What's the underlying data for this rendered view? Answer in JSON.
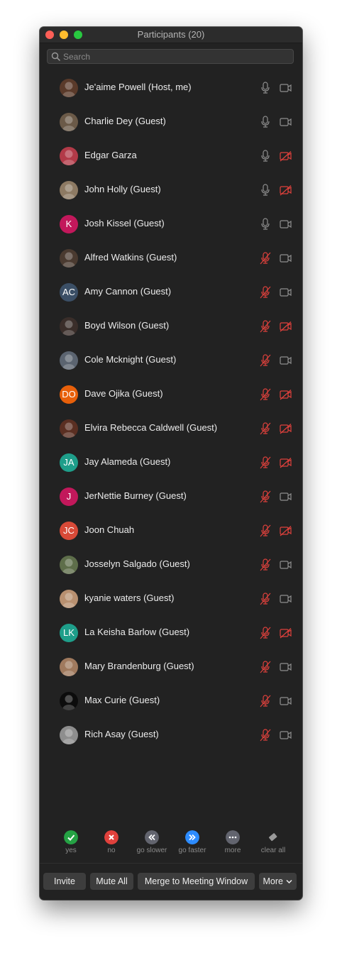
{
  "window": {
    "title": "Participants (20)"
  },
  "search": {
    "placeholder": "Search"
  },
  "participants": [
    {
      "name": "Je'aime Powell (Host, me)",
      "avatar_initials": "",
      "avatar_color": "#5a3a2a",
      "mic": "on",
      "video": "on"
    },
    {
      "name": "Charlie Dey (Guest)",
      "avatar_initials": "",
      "avatar_color": "#6b5a48",
      "mic": "on",
      "video": "on"
    },
    {
      "name": "Edgar Garza",
      "avatar_initials": "",
      "avatar_color": "#b23a48",
      "mic": "on",
      "video": "off"
    },
    {
      "name": "John Holly (Guest)",
      "avatar_initials": "",
      "avatar_color": "#8d7a63",
      "mic": "on",
      "video": "off"
    },
    {
      "name": "Josh Kissel (Guest)",
      "avatar_initials": "K",
      "avatar_color": "#c2185b",
      "mic": "on",
      "video": "on"
    },
    {
      "name": "Alfred Watkins (Guest)",
      "avatar_initials": "",
      "avatar_color": "#4a3a30",
      "mic": "muted",
      "video": "on"
    },
    {
      "name": "Amy Cannon (Guest)",
      "avatar_initials": "AC",
      "avatar_color": "#3b4f66",
      "mic": "muted",
      "video": "on"
    },
    {
      "name": "Boyd Wilson (Guest)",
      "avatar_initials": "",
      "avatar_color": "#3a2e2a",
      "mic": "muted",
      "video": "off"
    },
    {
      "name": "Cole Mcknight (Guest)",
      "avatar_initials": "",
      "avatar_color": "#5b6470",
      "mic": "muted",
      "video": "on"
    },
    {
      "name": "Dave Ojika (Guest)",
      "avatar_initials": "DO",
      "avatar_color": "#e8600a",
      "mic": "muted",
      "video": "off"
    },
    {
      "name": "Elvira Rebecca Caldwell (Guest)",
      "avatar_initials": "",
      "avatar_color": "#5a2f22",
      "mic": "muted",
      "video": "off"
    },
    {
      "name": "Jay Alameda (Guest)",
      "avatar_initials": "JA",
      "avatar_color": "#1e9e8a",
      "mic": "muted",
      "video": "off"
    },
    {
      "name": "JerNettie Burney (Guest)",
      "avatar_initials": "J",
      "avatar_color": "#c2185b",
      "mic": "muted",
      "video": "on"
    },
    {
      "name": "Joon Chuah",
      "avatar_initials": "JC",
      "avatar_color": "#d84a38",
      "mic": "muted",
      "video": "off"
    },
    {
      "name": "Josselyn Salgado (Guest)",
      "avatar_initials": "",
      "avatar_color": "#5e6e4a",
      "mic": "muted",
      "video": "on"
    },
    {
      "name": "kyanie waters (Guest)",
      "avatar_initials": "",
      "avatar_color": "#b89070",
      "mic": "muted",
      "video": "on"
    },
    {
      "name": "La Keisha Barlow (Guest)",
      "avatar_initials": "LK",
      "avatar_color": "#1e9e8a",
      "mic": "muted",
      "video": "off"
    },
    {
      "name": "Mary Brandenburg (Guest)",
      "avatar_initials": "",
      "avatar_color": "#a07a5e",
      "mic": "muted",
      "video": "on"
    },
    {
      "name": "Max Curie (Guest)",
      "avatar_initials": "",
      "avatar_color": "#0c0c0c",
      "mic": "muted",
      "video": "on"
    },
    {
      "name": "Rich Asay (Guest)",
      "avatar_initials": "",
      "avatar_color": "#8e8e8e",
      "mic": "muted",
      "video": "on"
    }
  ],
  "reactions": [
    {
      "label": "yes",
      "icon": "check-icon",
      "color": "#25a244"
    },
    {
      "label": "no",
      "icon": "x-icon",
      "color": "#e0413c"
    },
    {
      "label": "go slower",
      "icon": "rewind-icon",
      "color": "#62646e"
    },
    {
      "label": "go faster",
      "icon": "fast-forward-icon",
      "color": "#2d8cff"
    },
    {
      "label": "more",
      "icon": "ellipsis-icon",
      "color": "#62646e"
    },
    {
      "label": "clear all",
      "icon": "eraser-icon",
      "color": "#62646e"
    }
  ],
  "footer": {
    "invite": "Invite",
    "mute_all": "Mute All",
    "merge": "Merge to Meeting Window",
    "more": "More"
  },
  "colors": {
    "window_bg": "#222222",
    "muted_red": "#e0413c",
    "icon_gray": "#8f8f8f"
  }
}
